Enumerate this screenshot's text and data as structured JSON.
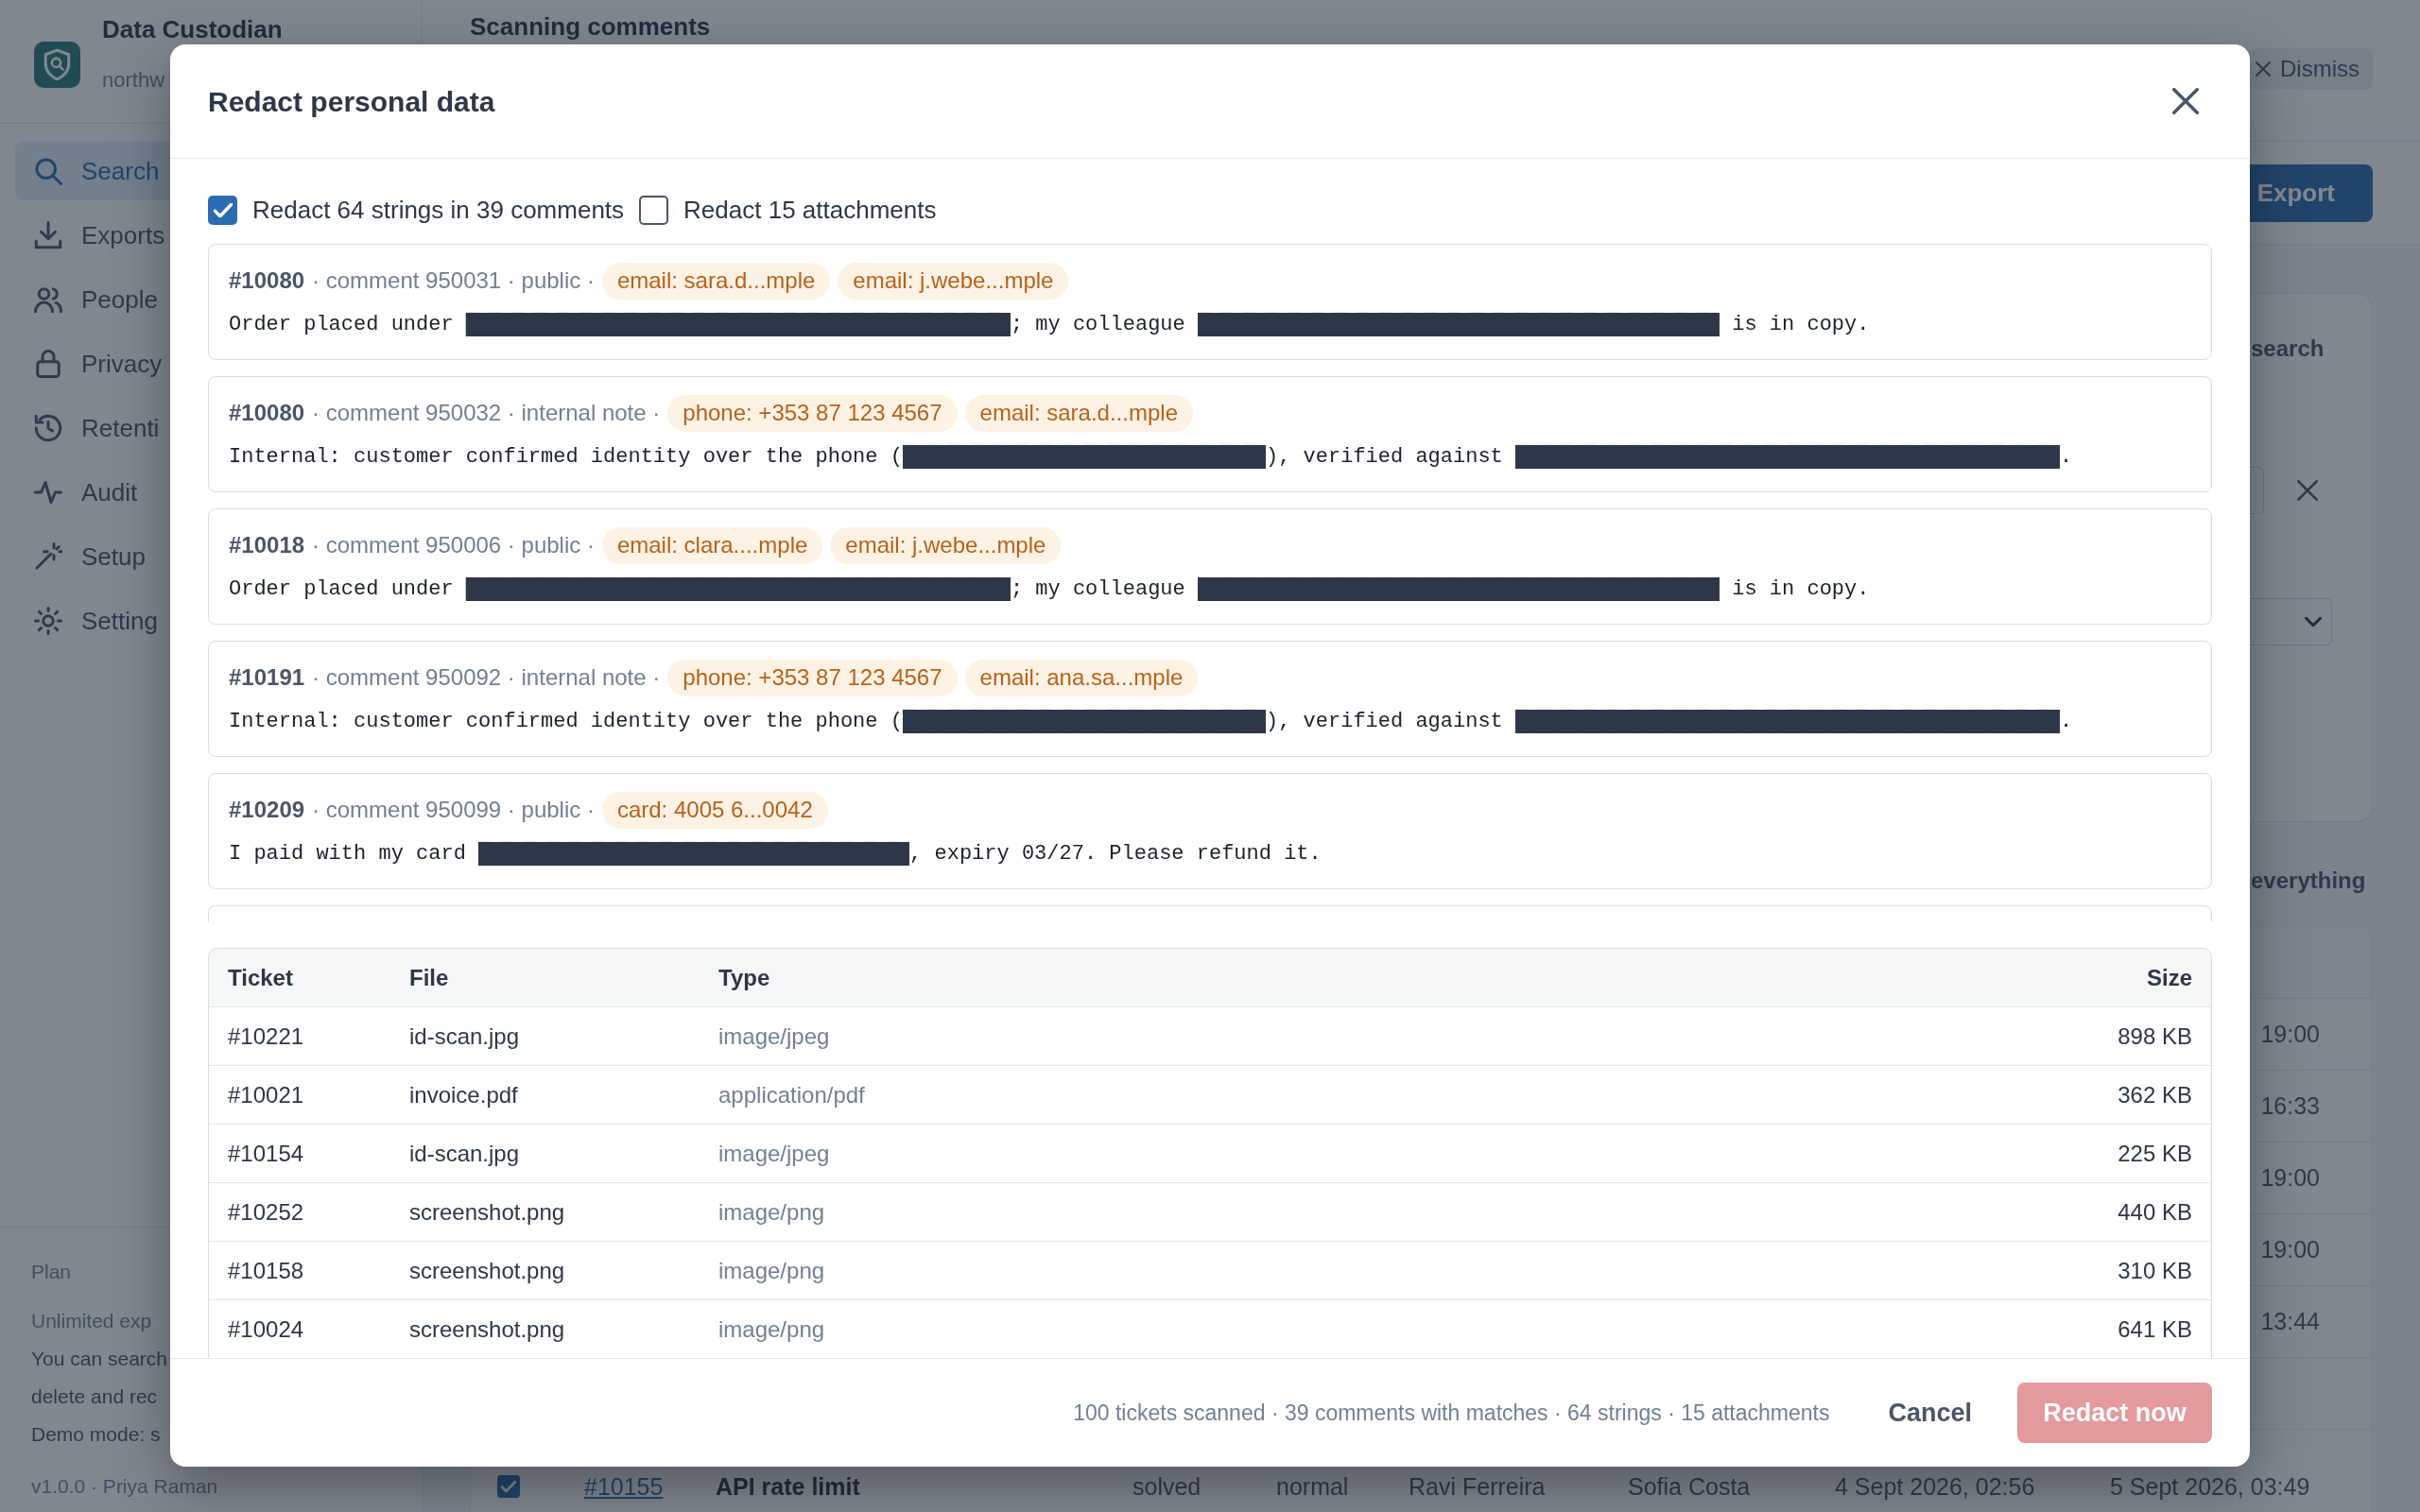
{
  "background": {
    "sidebar": {
      "app_name": "Data Custodian",
      "workspace": "northw",
      "nav": [
        {
          "label": "Search",
          "selected": true
        },
        {
          "label": "Exports",
          "selected": false
        },
        {
          "label": "People",
          "selected": false
        },
        {
          "label": "Privacy",
          "selected": false
        },
        {
          "label": "Retenti",
          "selected": false
        },
        {
          "label": "Audit",
          "selected": false
        },
        {
          "label": "Setup",
          "selected": false
        },
        {
          "label": "Setting",
          "selected": false
        }
      ],
      "plan": {
        "heading": "Plan",
        "lines": [
          {
            "kind": "muted",
            "text": "Unlimited exp"
          },
          {
            "kind": "body",
            "text": "You can search"
          },
          {
            "kind": "body",
            "text": "delete and rec"
          },
          {
            "kind": "body",
            "text": "Demo mode: s"
          }
        ]
      },
      "version": "v1.0.0 · Priya Raman"
    },
    "header": {
      "title": "Scanning comments",
      "dismiss_button": "Dismiss"
    },
    "export_button": "Export",
    "filter_panel": {
      "label": "search"
    },
    "results": {
      "label": "everything",
      "rows": [
        {
          "cells": [
            "19:00"
          ]
        },
        {
          "cells": [
            "16:33"
          ]
        },
        {
          "cells": [
            "19:00"
          ]
        },
        {
          "cells": [
            "19:00"
          ]
        },
        {
          "cells": [
            "13:44"
          ]
        }
      ],
      "last_row": {
        "checked": true,
        "cells": [
          "#10155",
          "API rate limit",
          "solved",
          "normal",
          "Ravi Ferreira",
          "Sofia Costa",
          "4 Sept 2026, 02:56",
          "5 Sept 2026, 03:49"
        ]
      }
    }
  },
  "modal": {
    "title": "Redact personal data",
    "options": [
      {
        "label": "Redact 64 strings in 39 comments",
        "checked": true
      },
      {
        "label": "Redact 15 attachments",
        "checked": false
      }
    ],
    "comments": {
      "items": [
        {
          "ticket": "#10080",
          "meta": "· comment 950031 · public ·",
          "matches": [
            "email: sara.d...mple",
            "email: j.webe...mple"
          ],
          "text": "Order placed under ████████████████████████; my colleague ███████████████████████ is in copy."
        },
        {
          "ticket": "#10080",
          "meta": "· comment 950032 · internal note ·",
          "matches": [
            "phone: +353 87 123 4567",
            "email: sara.d...mple"
          ],
          "text": "Internal: customer confirmed identity over the phone (████████████████), verified against ████████████████████████."
        },
        {
          "ticket": "#10018",
          "meta": "· comment 950006 · public ·",
          "matches": [
            "email: clara....mple",
            "email: j.webe...mple"
          ],
          "text": "Order placed under ████████████████████████; my colleague ███████████████████████ is in copy."
        },
        {
          "ticket": "#10191",
          "meta": "· comment 950092 · internal note ·",
          "matches": [
            "phone: +353 87 123 4567",
            "email: ana.sa...mple"
          ],
          "text": "Internal: customer confirmed identity over the phone (████████████████), verified against ████████████████████████."
        },
        {
          "ticket": "#10209",
          "meta": "· comment 950099 · public ·",
          "matches": [
            "card: 4005 6...0042"
          ],
          "text": "I paid with my card ███████████████████, expiry 03/27. Please refund it."
        }
      ],
      "more_below": true
    },
    "attachments": {
      "columns": [
        "Ticket",
        "File",
        "Type",
        "Size"
      ],
      "rows": [
        {
          "cells": [
            "#10221",
            "id-scan.jpg",
            "image/jpeg",
            "898 KB"
          ]
        },
        {
          "cells": [
            "#10021",
            "invoice.pdf",
            "application/pdf",
            "362 KB"
          ]
        },
        {
          "cells": [
            "#10154",
            "id-scan.jpg",
            "image/jpeg",
            "225 KB"
          ]
        },
        {
          "cells": [
            "#10252",
            "screenshot.png",
            "image/png",
            "440 KB"
          ]
        },
        {
          "cells": [
            "#10158",
            "screenshot.png",
            "image/png",
            "310 KB"
          ]
        },
        {
          "cells": [
            "#10024",
            "screenshot.png",
            "image/png",
            "641 KB"
          ]
        }
      ]
    },
    "summary": "100 tickets scanned · 39 comments with matches · 64 strings · 15 attachments",
    "cancel_button": "Cancel",
    "redact_button": {
      "label": "Redact now",
      "disabled": true
    }
  }
}
